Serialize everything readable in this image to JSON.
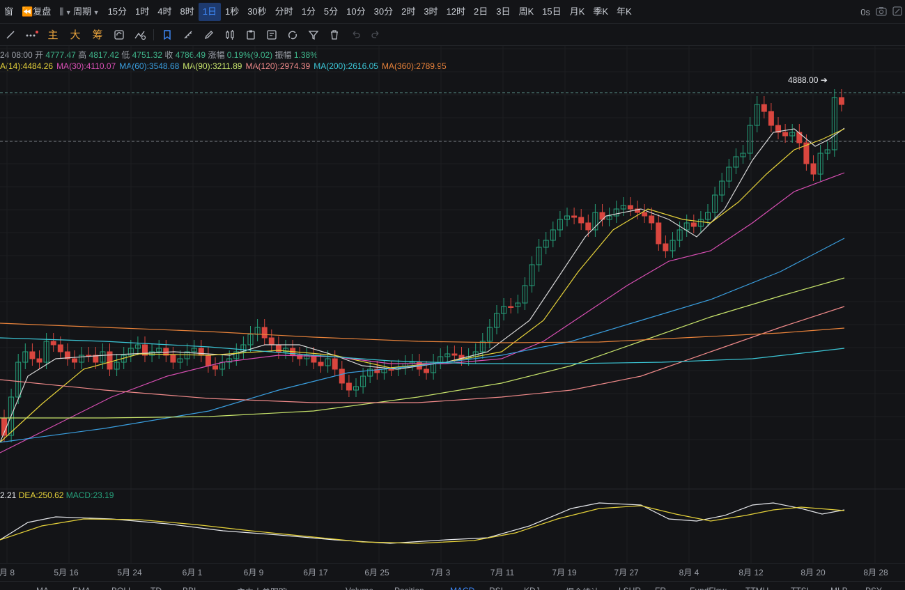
{
  "toolbar": {
    "window_label": "窗",
    "replay_label": "复盘",
    "period_label": "周期",
    "periods": [
      "15分",
      "1时",
      "4时",
      "8时",
      "1日",
      "1秒",
      "30秒",
      "分时",
      "1分",
      "5分",
      "10分",
      "30分",
      "2时",
      "3时",
      "12时",
      "2日",
      "3日",
      "周K",
      "15日",
      "月K",
      "季K",
      "年K"
    ],
    "active_period": "1日",
    "latency": "0s"
  },
  "drawing_toolbar": {
    "indicator_tools": [
      "主",
      "大",
      "筹"
    ]
  },
  "ohlc": {
    "date": "24 08:00",
    "open_label": "开",
    "open": "4777.47",
    "high_label": "高",
    "high": "4817.42",
    "low_label": "低",
    "low": "4751.32",
    "close_label": "收",
    "close": "4786.49",
    "change_label": "涨幅",
    "change": "0.19%(9.02)",
    "amplitude_label": "振幅",
    "amplitude": "1.38%"
  },
  "ma": [
    {
      "text": "A(14):4484.26",
      "color": "#e6d23a"
    },
    {
      "text": "MA(30):4110.07",
      "color": "#d94fb4"
    },
    {
      "text": "MA(60):3548.68",
      "color": "#3a9fe0"
    },
    {
      "text": "MA(90):3211.89",
      "color": "#c7e36b"
    },
    {
      "text": "MA(120):2974.39",
      "color": "#f08a8a"
    },
    {
      "text": "MA(200):2616.05",
      "color": "#3cc8d8"
    },
    {
      "text": "MA(360):2789.95",
      "color": "#e8823a"
    }
  ],
  "high_marker": "4888.00",
  "macd": {
    "dif": "2.21",
    "dea_label": "DEA:",
    "dea": "250.62",
    "macd_label": "MACD:",
    "macd_value": "23.19"
  },
  "x_labels": [
    "月 8",
    "5月 16",
    "5月 24",
    "6月 1",
    "6月 9",
    "6月 17",
    "6月 25",
    "7月 3",
    "7月 11",
    "7月 19",
    "7月 27",
    "8月 4",
    "8月 12",
    "8月 20",
    "8月 28"
  ],
  "bottom_tabs": [
    "MA",
    "EMA",
    "BOLL",
    "TD",
    "BBI",
    "主力大单跟踪",
    "Volume",
    "Position",
    "MACD",
    "RSI",
    "KDJ",
    "爆仓统计",
    "LSUR",
    "FR",
    "FundFlow",
    "TTMU",
    "TTSI",
    "MLP",
    "PSY"
  ],
  "active_bottom_tab": "MACD",
  "colors": {
    "up": "#26a17b",
    "down": "#d9463f",
    "accent": "#3f8cff",
    "background": "#131417"
  }
}
